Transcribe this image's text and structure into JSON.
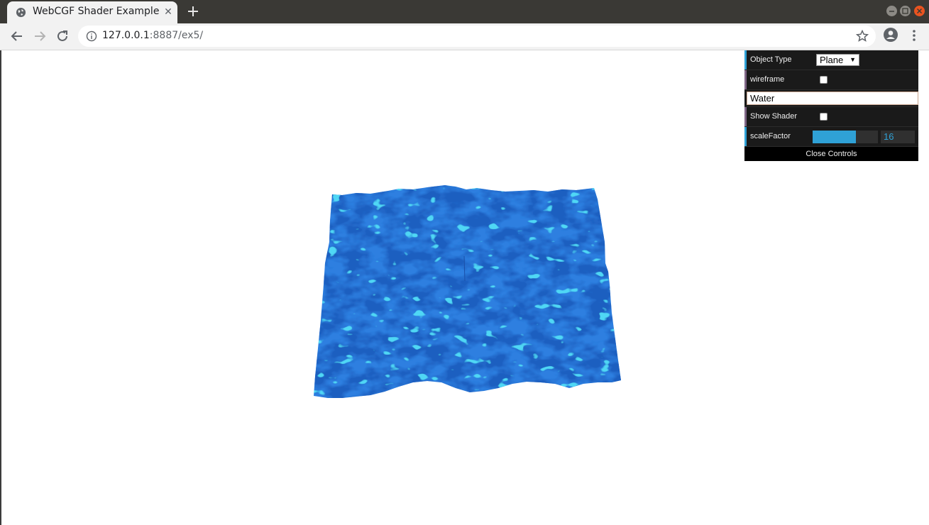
{
  "browser": {
    "tab_title": "WebCGF Shader Example",
    "tab_close": "✕",
    "url_host": "127.0.0.1",
    "url_rest": ":8887/ex5/",
    "icons": [
      "globe-icon",
      "close-icon",
      "plus-icon",
      "back-icon",
      "forward-icon",
      "reload-icon",
      "info-icon",
      "star-icon",
      "profile-icon",
      "kebab-menu-icon"
    ]
  },
  "gui": {
    "object_type_label": "Object Type",
    "object_type_value": "Plane",
    "wireframe_label": "wireframe",
    "wireframe_checked": false,
    "folder_title": "Water",
    "show_shader_label": "Show Shader",
    "show_shader_checked": false,
    "scale_factor_label": "scaleFactor",
    "scale_factor_value": "16",
    "scale_factor_fraction": 0.66,
    "close_controls": "Close Controls",
    "colors": {
      "number_accent": "#2fa1d6",
      "boolean_accent": "#806787",
      "panel_bg": "#1a1a1a"
    }
  },
  "scene": {
    "object": "water-plane",
    "colors": {
      "water_base": "#2f7fe0",
      "water_highlight": "#4fd7f5",
      "water_shadow": "#1f5fc0"
    }
  }
}
